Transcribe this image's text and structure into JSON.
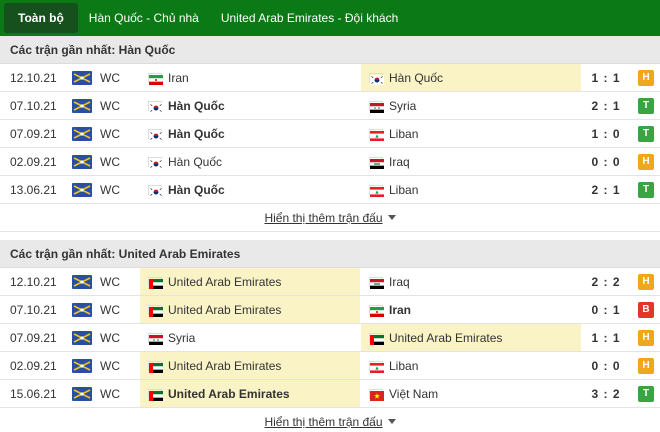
{
  "tabs": [
    {
      "label": "Toàn bộ",
      "active": true
    },
    {
      "label": "Hàn Quốc - Chủ nhà",
      "active": false
    },
    {
      "label": "United Arab Emirates - Đội khách",
      "active": false
    }
  ],
  "result_colors": {
    "H": "#f1a71d",
    "T": "#3aa342",
    "B": "#e2352c"
  },
  "sections": [
    {
      "title": "Các trận gần nhất: Hàn Quốc",
      "more_label": "Hiển thị thêm trận đấu",
      "matches": [
        {
          "date": "12.10.21",
          "league": "WC",
          "home": "Iran",
          "home_flag": "ir",
          "home_bold": false,
          "home_hl": false,
          "away": "Hàn Quốc",
          "away_flag": "kr",
          "away_bold": false,
          "away_hl": true,
          "score": "1 : 1",
          "result": "H"
        },
        {
          "date": "07.10.21",
          "league": "WC",
          "home": "Hàn Quốc",
          "home_flag": "kr",
          "home_bold": true,
          "home_hl": false,
          "away": "Syria",
          "away_flag": "sy",
          "away_bold": false,
          "away_hl": false,
          "score": "2 : 1",
          "result": "T"
        },
        {
          "date": "07.09.21",
          "league": "WC",
          "home": "Hàn Quốc",
          "home_flag": "kr",
          "home_bold": true,
          "home_hl": false,
          "away": "Liban",
          "away_flag": "lb",
          "away_bold": false,
          "away_hl": false,
          "score": "1 : 0",
          "result": "T"
        },
        {
          "date": "02.09.21",
          "league": "WC",
          "home": "Hàn Quốc",
          "home_flag": "kr",
          "home_bold": false,
          "home_hl": false,
          "away": "Iraq",
          "away_flag": "iq",
          "away_bold": false,
          "away_hl": false,
          "score": "0 : 0",
          "result": "H"
        },
        {
          "date": "13.06.21",
          "league": "WC",
          "home": "Hàn Quốc",
          "home_flag": "kr",
          "home_bold": true,
          "home_hl": false,
          "away": "Liban",
          "away_flag": "lb",
          "away_bold": false,
          "away_hl": false,
          "score": "2 : 1",
          "result": "T"
        }
      ]
    },
    {
      "title": "Các trận gần nhất: United Arab Emirates",
      "more_label": "Hiển thị thêm trận đấu",
      "matches": [
        {
          "date": "12.10.21",
          "league": "WC",
          "home": "United Arab Emirates",
          "home_flag": "ae",
          "home_bold": false,
          "home_hl": true,
          "away": "Iraq",
          "away_flag": "iq",
          "away_bold": false,
          "away_hl": false,
          "score": "2 : 2",
          "result": "H"
        },
        {
          "date": "07.10.21",
          "league": "WC",
          "home": "United Arab Emirates",
          "home_flag": "ae",
          "home_bold": false,
          "home_hl": true,
          "away": "Iran",
          "away_flag": "ir",
          "away_bold": true,
          "away_hl": false,
          "score": "0 : 1",
          "result": "B"
        },
        {
          "date": "07.09.21",
          "league": "WC",
          "home": "Syria",
          "home_flag": "sy",
          "home_bold": false,
          "home_hl": false,
          "away": "United Arab Emirates",
          "away_flag": "ae",
          "away_bold": false,
          "away_hl": true,
          "score": "1 : 1",
          "result": "H"
        },
        {
          "date": "02.09.21",
          "league": "WC",
          "home": "United Arab Emirates",
          "home_flag": "ae",
          "home_bold": false,
          "home_hl": true,
          "away": "Liban",
          "away_flag": "lb",
          "away_bold": false,
          "away_hl": false,
          "score": "0 : 0",
          "result": "H"
        },
        {
          "date": "15.06.21",
          "league": "WC",
          "home": "United Arab Emirates",
          "home_flag": "ae",
          "home_bold": true,
          "home_hl": true,
          "away": "Việt Nam",
          "away_flag": "vn",
          "away_bold": false,
          "away_hl": false,
          "score": "3 : 2",
          "result": "T"
        }
      ]
    }
  ]
}
